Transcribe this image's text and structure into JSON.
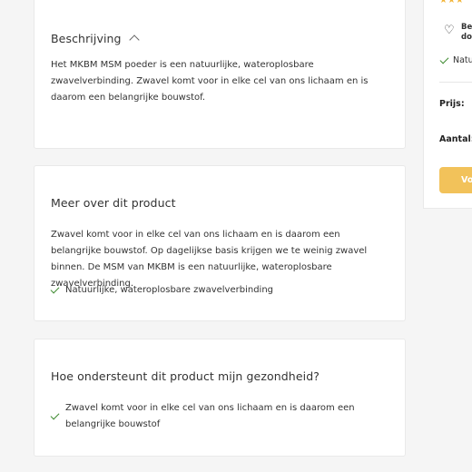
{
  "sections": [
    {
      "title": "Beschrijving",
      "text": "Het MKBM MSM poeder is een natuurlijke, wateroplosbare zwavelverbinding. Zwavel komt voor in elke cel van ons lichaam en is daarom een belangrijke bouwstof."
    },
    {
      "title": "Meer over dit product",
      "text": "Zwavel komt voor in elke cel van ons lichaam en is daarom een belangrijke bouwstof. Op dagelijkse basis krijgen we te weinig zwavel binnen. De MSM van MKBM is een natuurlijke, wateroplosbare zwavelverbinding.",
      "check": "Natuurlijke, wateroplosbare zwavelverbinding"
    },
    {
      "title": "Hoe ondersteunt dit product mijn gezondheid?",
      "check": "Zwavel komt voor in elke cel van ons lichaam en is daarom een belangrijke bouwstof"
    }
  ],
  "sidebar": {
    "stars": "★★★",
    "wishlist_line1": "Be",
    "wishlist_line2": "do",
    "check_text": "Natu",
    "price_label": "Prijs:",
    "qty_label": "Aantal:",
    "button_label": "Vo"
  },
  "colors": {
    "accent_button": "#f2c25a",
    "check_green": "#3d8a2f",
    "star": "#f2b53a"
  }
}
